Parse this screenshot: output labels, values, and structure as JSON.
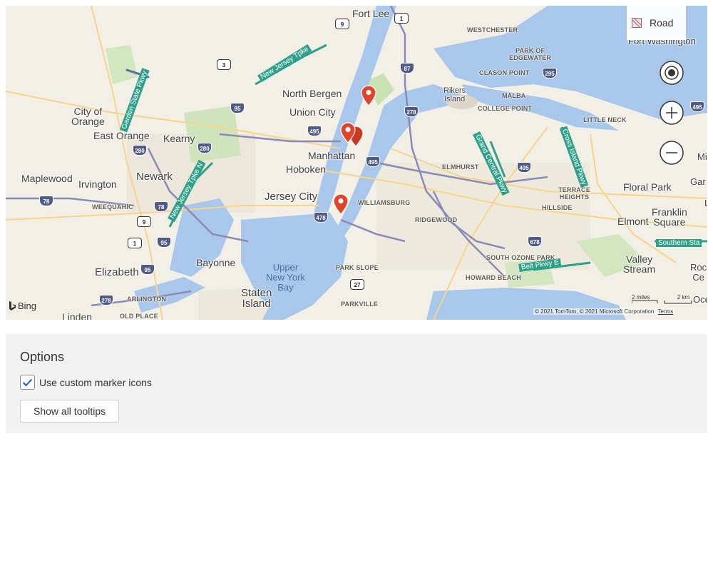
{
  "map": {
    "style_label": "Road",
    "places": {
      "fort_lee": "Fort Lee",
      "north_bergen": "North Bergen",
      "union_city": "Union City",
      "city_of_orange": "City of\nOrange",
      "east_orange": "East Orange",
      "kearny": "Kearny",
      "newark": "Newark",
      "maplewood": "Maplewood",
      "irvington": "Irvington",
      "manhattan": "Manhattan",
      "hoboken": "Hoboken",
      "jersey_city": "Jersey City",
      "bayonne": "Bayonne",
      "elizabeth": "Elizabeth",
      "staten_island": "Staten\nIsland",
      "linden": "Linden",
      "floral_park": "Floral Park",
      "franklin_square": "Franklin\nSquare",
      "elmont": "Elmont",
      "valley_stream": "Valley\nStream",
      "fort_washington": "Fort Washington",
      "rikers_island": "Rikers\nIsland"
    },
    "neighborhoods": {
      "westchester": "WESTCHESTER",
      "park_of_edgewater": "PARK OF\nEDGEWATER",
      "clason_point": "CLASON POINT",
      "malba": "MALBA",
      "college_point": "COLLEGE POINT",
      "little_neck": "LITTLE NECK",
      "elmhurst": "ELMHURST",
      "terrace_heights": "TERRACE\nHEIGHTS",
      "hillside": "HILLSIDE",
      "williamsburg": "WILLIAMSBURG",
      "ridgewood": "RIDGEWOOD",
      "weequahic": "WEEQUAHIC",
      "arlington": "ARLINGTON",
      "old_place": "OLD PLACE",
      "park_slope": "PARK SLOPE",
      "parkville": "PARKVILLE",
      "south_ozone_park": "SOUTH OZONE PARK",
      "howard_beach": "HOWARD BEACH"
    },
    "water": {
      "upper_ny_bay": "Upper\nNew York\nBay"
    },
    "highways": {
      "nj_tpke_north": "New Jersey Tpke",
      "nj_tpke_south": "New Jersey Tpke N",
      "garden_state": "Garden State Pkwy",
      "grand_central": "Grand Central Pkwy",
      "cross_island": "Cross Island Pkwy",
      "belt_pkwy": "Belt Pkwy E",
      "southern_state": "Southern Sta"
    },
    "shields": [
      "1",
      "9",
      "3",
      "87",
      "295",
      "95",
      "278",
      "495",
      "280",
      "78",
      "678",
      "27",
      "478"
    ],
    "edge_labels": {
      "mi": "Mi",
      "gar": "Gar",
      "roc": "Roc\nCe",
      "oce": "Oce",
      "l": "L",
      "e495": "495"
    },
    "bing_label": "Bing",
    "scale": {
      "miles": "2 miles",
      "km": "2 km"
    },
    "copyright": "© 2021 TomTom, © 2021 Microsoft Corporation",
    "terms": "Terms",
    "colors": {
      "land": "#f2efe6",
      "water": "#a8c7ea",
      "park": "#c8e2b4",
      "highway": "#5b6aa0",
      "marker": "#e0442a"
    }
  },
  "options": {
    "title": "Options",
    "custom_icons_label": "Use custom marker icons",
    "custom_icons_checked": true,
    "show_tooltips_label": "Show all tooltips"
  }
}
